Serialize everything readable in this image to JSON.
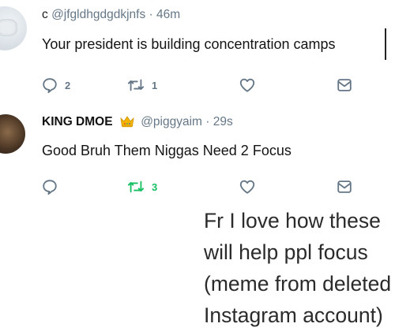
{
  "tweets": [
    {
      "handle_prefix": "c",
      "handle": "@jfgldhgdgdkjnfs",
      "separator": "·",
      "time": "46m",
      "text": "Your president is building concentration camps",
      "replies": "2",
      "retweets": "1",
      "retweet_active": false
    },
    {
      "display_name": "KING DMOE",
      "badge": "crown-emoji",
      "handle": "@piggyaim",
      "separator": "·",
      "time": "29s",
      "text": "Good Bruh Them Niggas Need 2 Focus",
      "replies": "",
      "retweets": "3",
      "retweet_active": true
    }
  ],
  "caption": "Fr I love how these will help ppl focus (meme from deleted Instagram account)",
  "colors": {
    "icon_gray": "#657786",
    "retweet_green": "#17bf63"
  },
  "icons": [
    "reply-icon",
    "retweet-icon",
    "like-icon",
    "share-icon",
    "crown-icon"
  ]
}
